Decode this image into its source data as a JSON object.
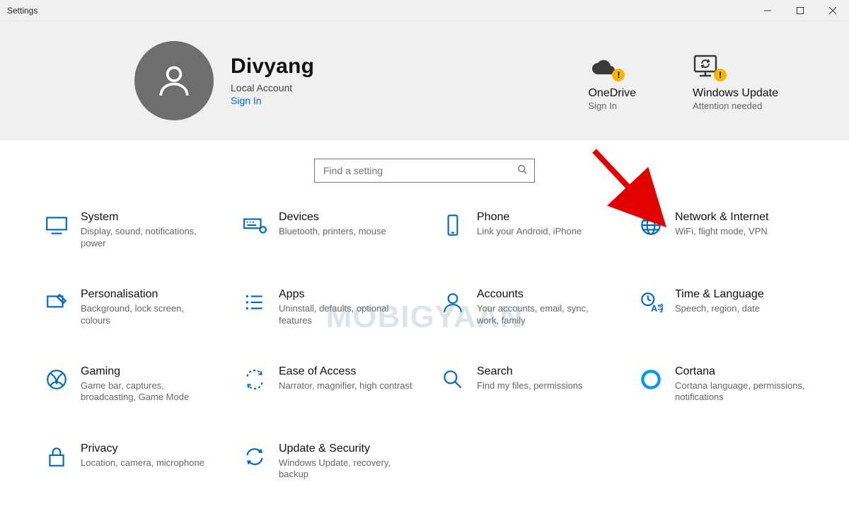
{
  "window": {
    "title": "Settings"
  },
  "user": {
    "name": "Divyang",
    "subtitle": "Local Account",
    "signin_label": "Sign In"
  },
  "header_status": {
    "onedrive": {
      "title": "OneDrive",
      "sub": "Sign In"
    },
    "update": {
      "title": "Windows Update",
      "sub": "Attention needed"
    }
  },
  "search": {
    "placeholder": "Find a setting"
  },
  "categories": {
    "system": {
      "title": "System",
      "desc": "Display, sound, notifications, power"
    },
    "devices": {
      "title": "Devices",
      "desc": "Bluetooth, printers, mouse"
    },
    "phone": {
      "title": "Phone",
      "desc": "Link your Android, iPhone"
    },
    "network": {
      "title": "Network & Internet",
      "desc": "WiFi, flight mode, VPN"
    },
    "personalisation": {
      "title": "Personalisation",
      "desc": "Background, lock screen, colours"
    },
    "apps": {
      "title": "Apps",
      "desc": "Uninstall, defaults, optional features"
    },
    "accounts": {
      "title": "Accounts",
      "desc": "Your accounts, email, sync, work, family"
    },
    "time": {
      "title": "Time & Language",
      "desc": "Speech, region, date"
    },
    "gaming": {
      "title": "Gaming",
      "desc": "Game bar, captures, broadcasting, Game Mode"
    },
    "ease": {
      "title": "Ease of Access",
      "desc": "Narrator, magnifier, high contrast"
    },
    "searchcat": {
      "title": "Search",
      "desc": "Find my files, permissions"
    },
    "cortana": {
      "title": "Cortana",
      "desc": "Cortana language, permissions, notifications"
    },
    "privacy": {
      "title": "Privacy",
      "desc": "Location, camera, microphone"
    },
    "updatesec": {
      "title": "Update & Security",
      "desc": "Windows Update, recovery, backup"
    }
  },
  "watermark": "MOBIGYAAN",
  "colors": {
    "accent": "#0067c0",
    "warn": "#f7b500"
  }
}
